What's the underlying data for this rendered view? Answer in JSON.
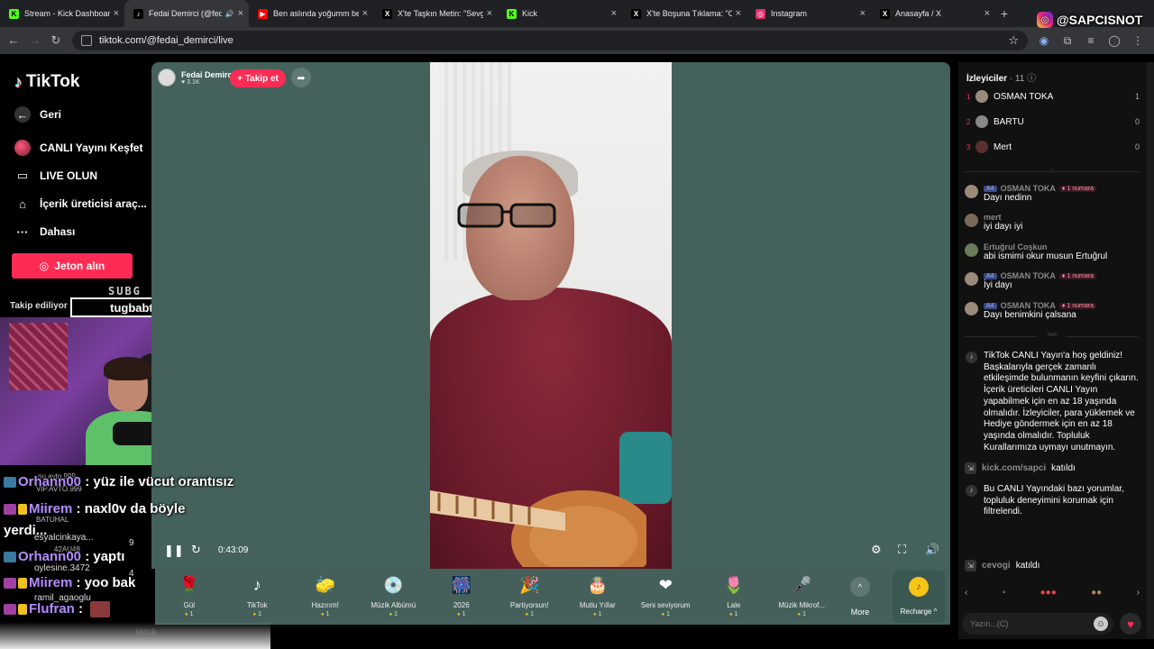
{
  "browser": {
    "tabs": [
      {
        "title": "Stream - Kick Dashboard",
        "favicon_color": "#53fc18",
        "favicon_glyph": "K",
        "active": false
      },
      {
        "title": "Fedai Demirci (@feda",
        "favicon_color": "#000000",
        "favicon_glyph": "♪",
        "active": true,
        "audio": "speaker-icon"
      },
      {
        "title": "Ben aslında yoğumm ben",
        "favicon_color": "#ff0000",
        "favicon_glyph": "▶",
        "active": false
      },
      {
        "title": "X'te Taşkın Metin: \"Sevgili",
        "favicon_color": "#000000",
        "favicon_glyph": "X",
        "active": false
      },
      {
        "title": "Kick",
        "favicon_color": "#53fc18",
        "favicon_glyph": "K",
        "active": false
      },
      {
        "title": "X'te Boşuna Tıklama: \"Or",
        "favicon_color": "#000000",
        "favicon_glyph": "X",
        "active": false
      },
      {
        "title": "Instagram",
        "favicon_color": "#e1306c",
        "favicon_glyph": "◎",
        "active": false
      },
      {
        "title": "Anasayfa / X",
        "favicon_color": "#000000",
        "favicon_glyph": "X",
        "active": false
      }
    ],
    "new_tab": "+",
    "url": "tiktok.com/@fedai_demirci/live"
  },
  "overlay": {
    "instagram_handle": "@SAPCISNOT",
    "subg_label": "SUBG",
    "streamer_name": "tugbabtw"
  },
  "sidebar": {
    "logo": "TikTok",
    "items": [
      {
        "label": "Geri",
        "icon": "back-arrow-icon"
      },
      {
        "label": "CANLI Yayını Keşfet",
        "icon": "live-explore-icon"
      },
      {
        "label": "LIVE OLUN",
        "icon": "video-camera-icon"
      },
      {
        "label": "İçerik üreticisi araç...",
        "icon": "creator-tools-icon"
      },
      {
        "label": "Dahası",
        "icon": "more-dots-icon"
      }
    ],
    "coin_button": "Jeton alın",
    "following_label": "Takip ediliyor"
  },
  "stream_chat_overlay": [
    {
      "name": "Orhann00",
      "text": " : yüz ile vücut orantısız"
    },
    {
      "name": "Miirem",
      "text": " : naxl0v da böyle"
    },
    {
      "name": "",
      "text": "yerdi..."
    },
    {
      "name": "Orhann00",
      "text": " : yaptı"
    },
    {
      "name": "Miirem",
      "text": " : yoo bak"
    },
    {
      "name": "Flufran",
      "text": " :"
    }
  ],
  "stream_chat_small": [
    "nu.avto.999",
    "VIP.AVTO.999",
    "tuba",
    "BATUHAL",
    "esyalcinkaya...",
    "42AU48",
    "oylesine.3472",
    "ramil_agaoglu",
    "tiktok"
  ],
  "stream_chat_numbers": [
    "9",
    "4"
  ],
  "live": {
    "host_name": "Fedai Demirci",
    "host_likes": "3.1K",
    "follow_label": "+ Takip et",
    "time": "0:43:09"
  },
  "gifts": [
    {
      "name": "Gül",
      "price": "1",
      "icon": "🌹"
    },
    {
      "name": "TikTok",
      "price": "1",
      "icon": "♪"
    },
    {
      "name": "Hazırım!",
      "price": "1",
      "icon": "🧽"
    },
    {
      "name": "Müzik Albümü",
      "price": "1",
      "icon": "💿"
    },
    {
      "name": "2026",
      "price": "1",
      "icon": "🎆"
    },
    {
      "name": "Partiyorsun!",
      "price": "1",
      "icon": "🎉"
    },
    {
      "name": "Mutlu Yıllar",
      "price": "1",
      "icon": "🎂"
    },
    {
      "name": "Seni seviyorum",
      "price": "1",
      "icon": "❤"
    },
    {
      "name": "Lale",
      "price": "1",
      "icon": "🌷"
    },
    {
      "name": "Müzik Mikrof...",
      "price": "1",
      "icon": "🎤"
    }
  ],
  "more_label": "More",
  "recharge_label": "Recharge",
  "viewers": {
    "title": "İzleyiciler",
    "count": "11",
    "list": [
      {
        "rank": "1",
        "name": "OSMAN TOKA",
        "score": "1",
        "color": "#9a8a7a"
      },
      {
        "rank": "2",
        "name": "BARTU",
        "score": "0",
        "color": "#888888"
      },
      {
        "rank": "3",
        "name": "Mert",
        "score": "0",
        "color": "#5a3030"
      }
    ]
  },
  "comments": [
    {
      "user": "OSMAN TOKA",
      "level": "A4",
      "tag": "1 numara",
      "text": "Dayı nedinn",
      "color": "#9a8a7a"
    },
    {
      "user": "mert",
      "level": "",
      "tag": "",
      "text": "iyi dayı iyi",
      "color": "#7a6a5a"
    },
    {
      "user": "Ertuğrul Coşkun",
      "level": "",
      "tag": "",
      "text": "abi ismimi okur musun Ertuğrul",
      "color": "#6a7a5a"
    },
    {
      "user": "OSMAN TOKA",
      "level": "A4",
      "tag": "1 numara",
      "text": "İyi dayı",
      "color": "#9a8a7a"
    },
    {
      "user": "OSMAN TOKA",
      "level": "A4",
      "tag": "1 numara",
      "text": "Dayı benimkini çalsana",
      "color": "#9a8a7a"
    }
  ],
  "new_divider": "Yeni",
  "system_welcome": "TikTok CANLI Yayın'a hoş geldiniz! Başkalarıyla gerçek zamanlı etkileşimde bulunmanın keyfini çıkarın. İçerik üreticileri CANLI Yayın yapabilmek için en az 18 yaşında olmalıdır. İzleyiciler, para yüklemek ve Hediye göndermek için en az 18 yaşında olmalıdır. Topluluk Kurallarımıza uymayı unutmayın.",
  "join1": {
    "user": "kick.com/sapci",
    "text": "katıldı"
  },
  "system_filter": "Bu CANLI Yayındaki bazı yorumlar, topluluk deneyimini korumak için filtrelendi.",
  "join2": {
    "user": "cevogi",
    "text": "katıldı"
  },
  "chat_input_placeholder": "Yazın...(C)"
}
